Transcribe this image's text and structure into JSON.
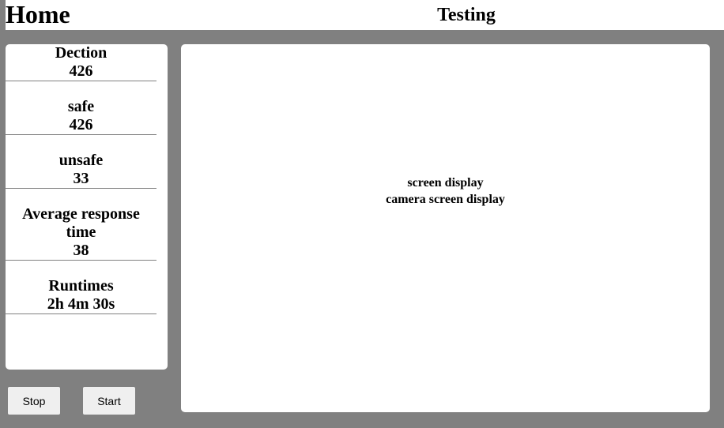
{
  "header": {
    "home": "Home",
    "title": "Testing"
  },
  "stats": [
    {
      "label": "Dection",
      "value": "426"
    },
    {
      "label": "safe",
      "value": "426"
    },
    {
      "label": "unsafe",
      "value": "33"
    },
    {
      "label": "Average response time",
      "value": "38"
    },
    {
      "label": "Runtimes",
      "value": "2h 4m 30s"
    }
  ],
  "main": {
    "line1": "screen display",
    "line2": "camera screen display"
  },
  "buttons": {
    "stop": "Stop",
    "start": "Start"
  }
}
